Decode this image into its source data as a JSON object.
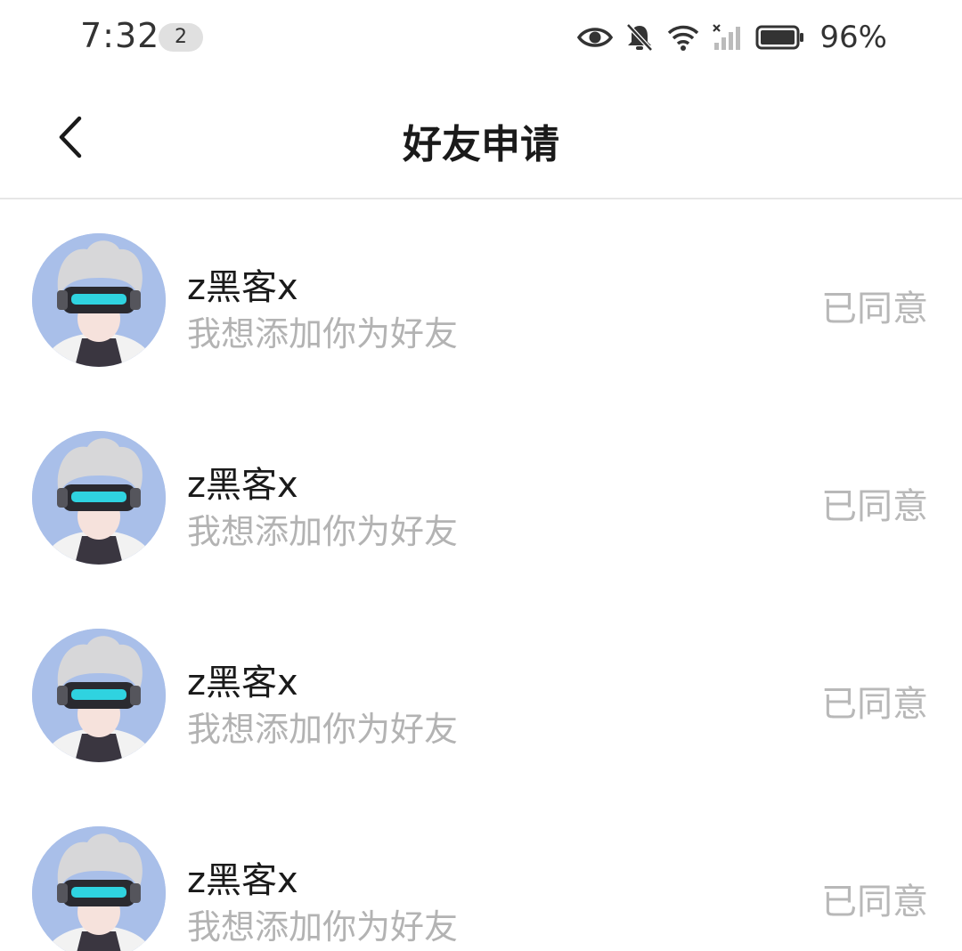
{
  "status_bar": {
    "time": "7:32",
    "notification_count": "2",
    "battery_text": "96%",
    "icons": [
      "eye-icon",
      "bell-muted-icon",
      "wifi-icon",
      "signal-icon",
      "battery-icon"
    ]
  },
  "header": {
    "title": "好友申请",
    "back_icon": "chevron-left-icon"
  },
  "requests": [
    {
      "name": "z黑客x",
      "message": "我想添加你为好友",
      "status": "已同意"
    },
    {
      "name": "z黑客x",
      "message": "我想添加你为好友",
      "status": "已同意"
    },
    {
      "name": "z黑客x",
      "message": "我想添加你为好友",
      "status": "已同意"
    },
    {
      "name": "z黑客x",
      "message": "我想添加你为好友",
      "status": "已同意"
    }
  ],
  "colors": {
    "accent_visor": "#2fd3e0",
    "muted_text": "#b3b3b3",
    "divider": "#e6e6e6"
  }
}
